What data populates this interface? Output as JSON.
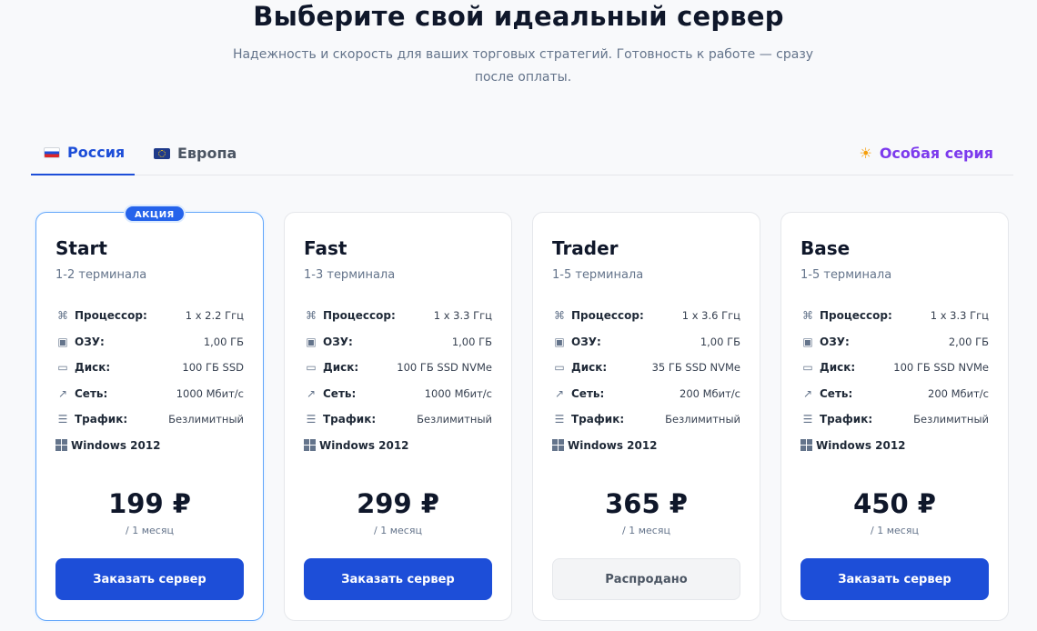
{
  "header": {
    "title": "Выберите свой идеальный сервер",
    "subtitle": "Надежность и скорость для ваших торговых стратегий. Готовность к работе — сразу после оплаты."
  },
  "tabs": [
    {
      "label": "Россия",
      "state": "active"
    },
    {
      "label": "Европа",
      "state": "inactive"
    },
    {
      "label": "Особая серия",
      "state": "special"
    }
  ],
  "spec_labels": {
    "cpu": "Процессор:",
    "ram": "ОЗУ:",
    "disk": "Диск:",
    "net": "Сеть:",
    "traffic": "Трафик:"
  },
  "plans": [
    {
      "name": "Start",
      "badge": "АКЦИЯ",
      "terminals": "1-2 терминала",
      "cpu": "1 x 2.2 Ггц",
      "ram": "1,00 ГБ",
      "disk": "100 ГБ SSD",
      "net": "1000 Мбит/с",
      "traffic": "Безлимитный",
      "os": "Windows 2012",
      "price": "199 ₽",
      "period": "/ 1 месяц",
      "button": "Заказать сервер"
    },
    {
      "name": "Fast",
      "terminals": "1-3 терминала",
      "cpu": "1 x 3.3 Ггц",
      "ram": "1,00 ГБ",
      "disk": "100 ГБ SSD NVMe",
      "net": "1000 Мбит/с",
      "traffic": "Безлимитный",
      "os": "Windows 2012",
      "price": "299 ₽",
      "period": "/ 1 месяц",
      "button": "Заказать сервер"
    },
    {
      "name": "Trader",
      "terminals": "1-5 терминала",
      "cpu": "1 x 3.6 Ггц",
      "ram": "1,00 ГБ",
      "disk": "35 ГБ SSD NVMe",
      "net": "200 Мбит/с",
      "traffic": "Безлимитный",
      "os": "Windows 2012",
      "price": "365 ₽",
      "period": "/ 1 месяц",
      "button": "Распродано"
    },
    {
      "name": "Base",
      "terminals": "1-5 терминала",
      "cpu": "1 x 3.3 Ггц",
      "ram": "2,00 ГБ",
      "disk": "100 ГБ SSD NVMe",
      "net": "200 Мбит/с",
      "traffic": "Безлимитный",
      "os": "Windows 2012",
      "price": "450 ₽",
      "period": "/ 1 месяц",
      "button": "Заказать сервер"
    }
  ]
}
